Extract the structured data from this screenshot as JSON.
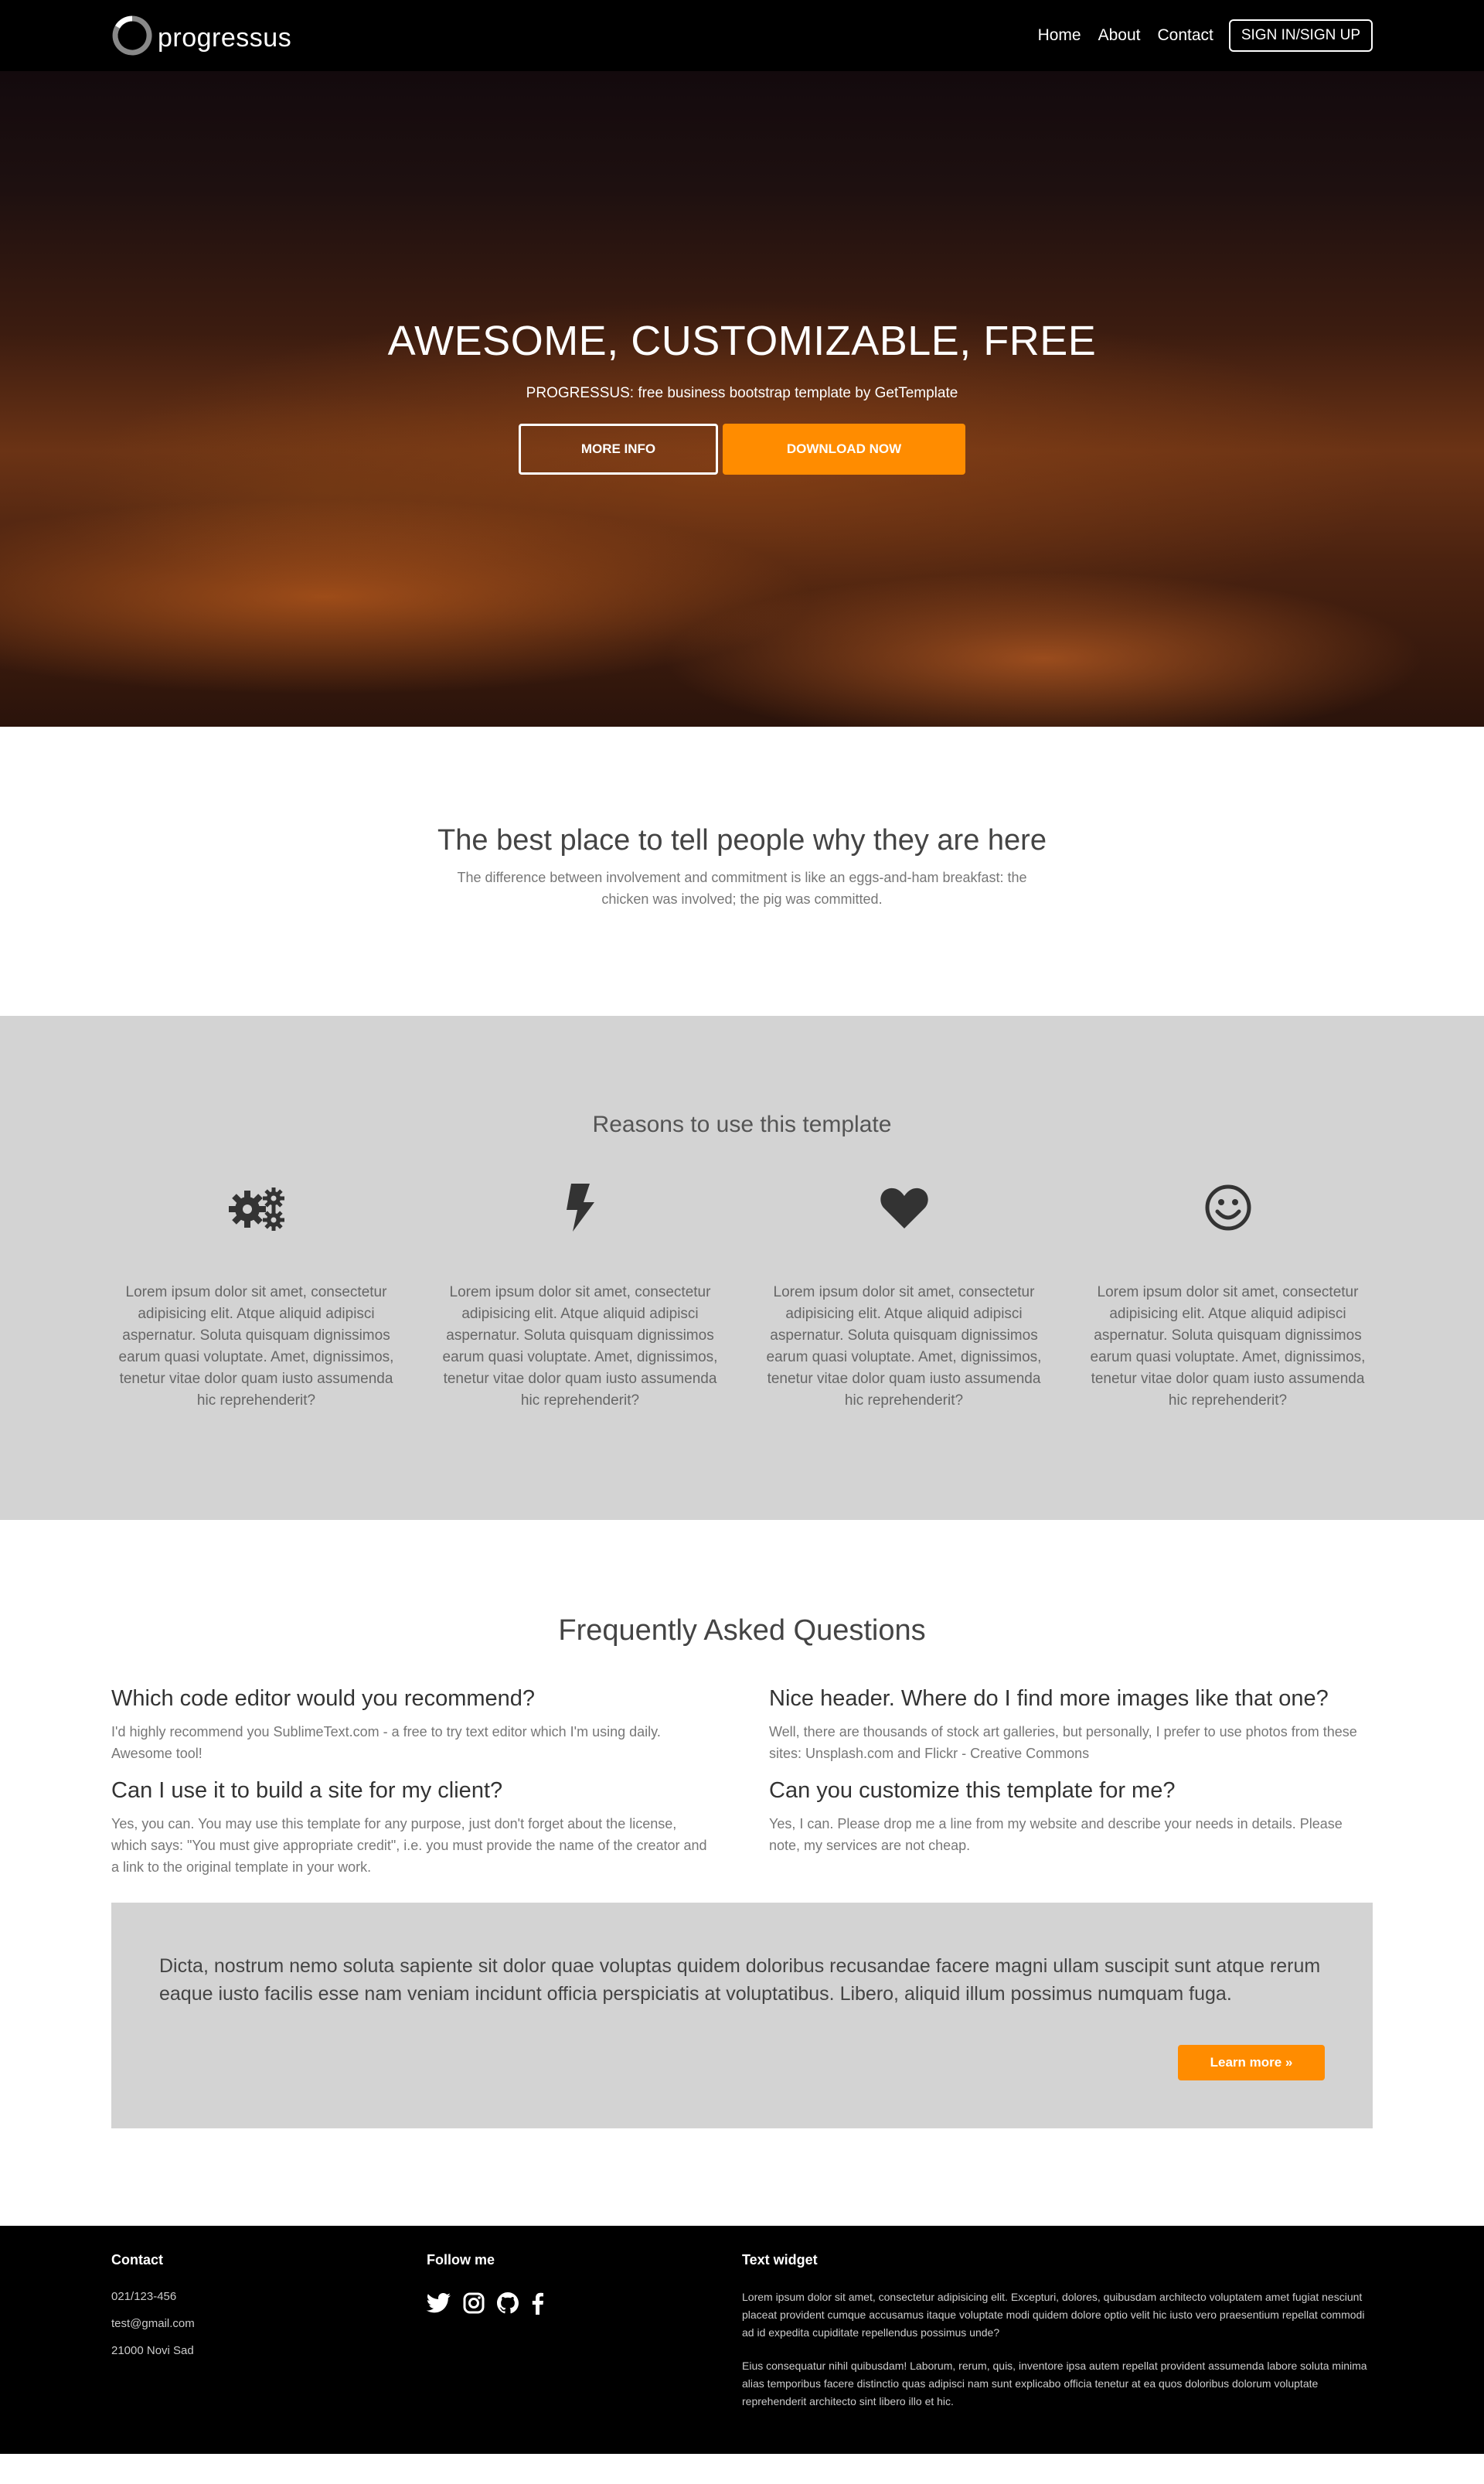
{
  "nav": {
    "brand": "progressus",
    "links": [
      "Home",
      "About",
      "Contact"
    ],
    "signin": "SIGN IN/SIGN UP"
  },
  "hero": {
    "title": "AWESOME, CUSTOMIZABLE, FREE",
    "subtitle": "PROGRESSUS: free business bootstrap template by GetTemplate",
    "more_info": "MORE INFO",
    "download": "DOWNLOAD NOW"
  },
  "intro": {
    "title": "The best place to tell people why they are here",
    "text": "The difference between involvement and commitment is like an eggs-and-ham breakfast: the chicken was involved; the pig was committed."
  },
  "reasons": {
    "title": "Reasons to use this template",
    "items": [
      {
        "icon": "gears-icon",
        "text": "Lorem ipsum dolor sit amet, consectetur adipisicing elit. Atque aliquid adipisci aspernatur. Soluta quisquam dignissimos earum quasi voluptate. Amet, dignissimos, tenetur vitae dolor quam iusto assumenda hic reprehenderit?"
      },
      {
        "icon": "flash-icon",
        "text": "Lorem ipsum dolor sit amet, consectetur adipisicing elit. Atque aliquid adipisci aspernatur. Soluta quisquam dignissimos earum quasi voluptate. Amet, dignissimos, tenetur vitae dolor quam iusto assumenda hic reprehenderit?"
      },
      {
        "icon": "heart-icon",
        "text": "Lorem ipsum dolor sit amet, consectetur adipisicing elit. Atque aliquid adipisci aspernatur. Soluta quisquam dignissimos earum quasi voluptate. Amet, dignissimos, tenetur vitae dolor quam iusto assumenda hic reprehenderit?"
      },
      {
        "icon": "smile-icon",
        "text": "Lorem ipsum dolor sit amet, consectetur adipisicing elit. Atque aliquid adipisci aspernatur. Soluta quisquam dignissimos earum quasi voluptate. Amet, dignissimos, tenetur vitae dolor quam iusto assumenda hic reprehenderit?"
      }
    ]
  },
  "faq": {
    "title": "Frequently Asked Questions",
    "items": [
      {
        "q": "Which code editor would you recommend?",
        "a": "I'd highly recommend you SublimeText.com - a free to try text editor which I'm using daily. Awesome tool!"
      },
      {
        "q": "Nice header. Where do I find more images like that one?",
        "a": "Well, there are thousands of stock art galleries, but personally, I prefer to use photos from these sites: Unsplash.com and Flickr - Creative Commons"
      },
      {
        "q": "Can I use it to build a site for my client?",
        "a": "Yes, you can. You may use this template for any purpose, just don't forget about the license, which says: \"You must give appropriate credit\", i.e. you must provide the name of the creator and a link to the original template in your work."
      },
      {
        "q": "Can you customize this template for me?",
        "a": "Yes, I can. Please drop me a line from my website and describe your needs in details. Please note, my services are not cheap."
      }
    ],
    "jumbo_text": "Dicta, nostrum nemo soluta sapiente sit dolor quae voluptas quidem doloribus recusandae facere magni ullam suscipit sunt atque rerum eaque iusto facilis esse nam veniam incidunt officia perspiciatis at voluptatibus. Libero, aliquid illum possimus numquam fuga.",
    "learn_more": "Learn more »"
  },
  "footer": {
    "contact_title": "Contact",
    "phone": "021/123-456",
    "email": "test@gmail.com",
    "address": "21000 Novi Sad",
    "follow_title": "Follow me",
    "social": [
      "twitter-icon",
      "instagram-icon",
      "github-icon",
      "facebook-icon"
    ],
    "widget_title": "Text widget",
    "widget_p1": "Lorem ipsum dolor sit amet, consectetur adipisicing elit. Excepturi, dolores, quibusdam architecto voluptatem amet fugiat nesciunt placeat provident cumque accusamus itaque voluptate modi quidem dolore optio velit hic iusto vero praesentium repellat commodi ad id expedita cupiditate repellendus possimus unde?",
    "widget_p2": "Eius consequatur nihil quibusdam! Laborum, rerum, quis, inventore ipsa autem repellat provident assumenda labore soluta minima alias temporibus facere distinctio quas adipisci nam sunt explicabo officia tenetur at ea quos doloribus dolorum voluptate reprehenderit architecto sint libero illo et hic."
  },
  "colors": {
    "accent": "#ff8c00",
    "nav_bg": "#000000",
    "panel_bg": "#d3d3d3"
  }
}
